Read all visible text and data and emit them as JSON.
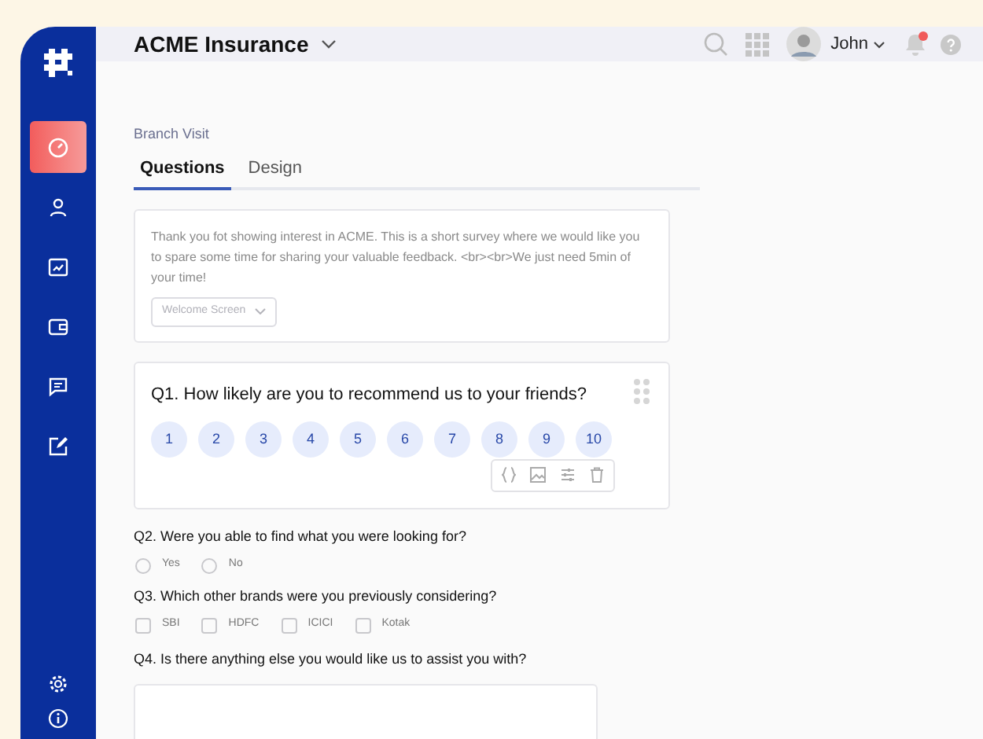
{
  "header": {
    "org": "ACME Insurance",
    "user": "John",
    "notification_dot": true
  },
  "sidebar": {
    "items": [
      {
        "kind": "dashboard",
        "selected": true
      },
      {
        "kind": "user",
        "selected": false
      },
      {
        "kind": "chart",
        "selected": false
      },
      {
        "kind": "wallet",
        "selected": false
      },
      {
        "kind": "chat",
        "selected": false
      },
      {
        "kind": "edit",
        "selected": false
      }
    ],
    "footer": [
      {
        "kind": "settings"
      },
      {
        "kind": "info"
      }
    ]
  },
  "survey": {
    "title": "Branch Visit",
    "tabs": [
      {
        "label": "Questions",
        "selected": true
      },
      {
        "label": "Design",
        "selected": false
      }
    ],
    "welcome": {
      "text": "Thank you fot showing interest in ACME. This is a short survey where we would  like you to spare some time for sharing your valuable feedback. <br><br>We just need 5min of your time!",
      "dropdown": "Welcome Screen"
    },
    "questions": [
      {
        "kind": "scale",
        "text": "Q1. How likely are you to recommend us to your friends?",
        "options": [
          "1",
          "2",
          "3",
          "4",
          "5",
          "6",
          "7",
          "8",
          "9",
          "10"
        ]
      },
      {
        "kind": "radio",
        "text": "Q2. Were you able to find what you were looking for?",
        "options": [
          {
            "label": "Yes",
            "selected": false
          },
          {
            "label": "No",
            "selected": false
          }
        ]
      },
      {
        "kind": "checkbox",
        "text": "Q3. Which other brands were you previously considering?",
        "options": [
          {
            "label": "SBI",
            "checked": false
          },
          {
            "label": "HDFC",
            "checked": false
          },
          {
            "label": "ICICI",
            "checked": false
          },
          {
            "label": "Kotak",
            "checked": false
          }
        ]
      },
      {
        "kind": "text",
        "text": "Q4. Is there anything else you would like us to assist you with?"
      }
    ]
  }
}
